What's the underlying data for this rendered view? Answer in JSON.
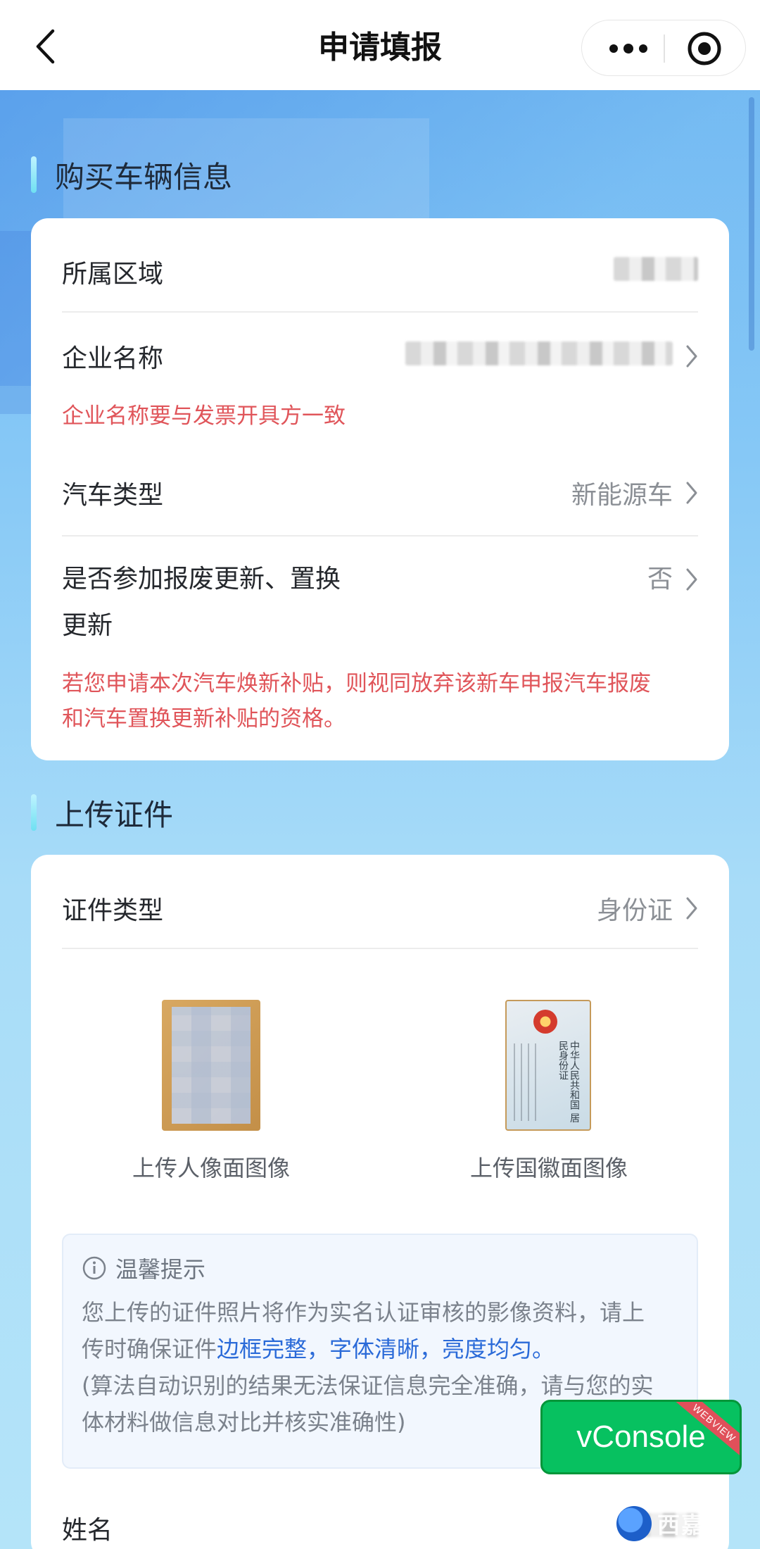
{
  "nav": {
    "title": "申请填报"
  },
  "section_vehicle": {
    "title": "购买车辆信息",
    "rows": [
      {
        "label": "所属区域",
        "value": ""
      },
      {
        "label": "企业名称",
        "value": "",
        "hint": "企业名称要与发票开具方一致"
      },
      {
        "label": "汽车类型",
        "value": "新能源车"
      },
      {
        "label_line1": "是否参加报废更新、置换",
        "label_line2": "更新",
        "value": "否",
        "hint_line1": "若您申请本次汽车焕新补贴，则视同放弃该新车申报汽车报废",
        "hint_line2": "和汽车置换更新补贴的资格。"
      }
    ]
  },
  "section_upload": {
    "title": "上传证件",
    "cert_type_label": "证件类型",
    "cert_type_value": "身份证",
    "front_label": "上传人像面图像",
    "back_label": "上传国徽面图像",
    "id_back_text": "中华人民共和国 居民身份证",
    "tip_title": "温馨提示",
    "tip_line1": "您上传的证件照片将作为实名认证审核的影像资料，请上",
    "tip_line2_pre": "传时确保证件",
    "tip_line2_blue": "边框完整，字体清晰，亮度均匀。",
    "tip_line3": "(算法自动识别的结果无法保证信息完全准确，请与您的实",
    "tip_line4": "体材料做信息对比并核实准确性)",
    "name_label": "姓名"
  },
  "vconsole": {
    "label": "vConsole",
    "ribbon": "WEBVIEW"
  },
  "watermark": {
    "text": "西嘉"
  },
  "colors": {
    "accent_red": "#e0555a",
    "accent_blue": "#2a6ad8",
    "vconsole_green": "#07c160"
  }
}
